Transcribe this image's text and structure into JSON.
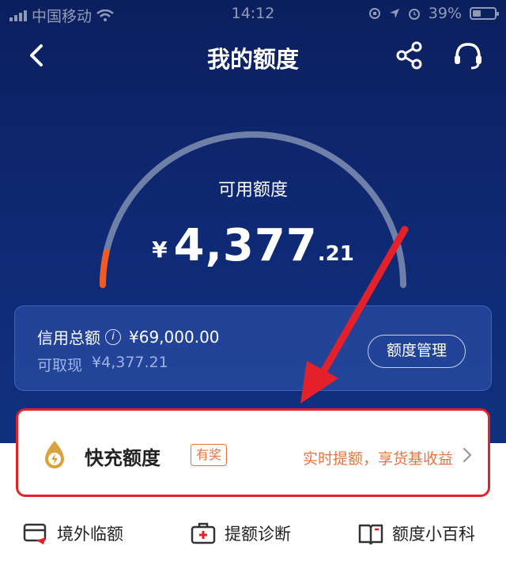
{
  "status_bar": {
    "carrier": "中国移动",
    "time": "14:12",
    "battery": "39%",
    "battery_level": 0.39
  },
  "nav": {
    "title": "我的额度"
  },
  "available": {
    "label": "可用额度",
    "currency": "¥",
    "amount_int": "4,377",
    "amount_dec": ".21"
  },
  "credit": {
    "total_label": "信用总额",
    "total_value": "¥69,000.00",
    "cash_label": "可取现",
    "cash_value": "¥4,377.21",
    "manage_label": "额度管理"
  },
  "quick_charge": {
    "title": "快充额度",
    "badge": "有奖",
    "promo": "实时提额，享货基收益"
  },
  "shortcuts": [
    {
      "label": "境外临额"
    },
    {
      "label": "提额诊断"
    },
    {
      "label": "额度小百科"
    }
  ],
  "colors": {
    "hero_bg": "#0f2a75",
    "accent_orange": "#e8743c",
    "annotation_red": "#e4202a"
  }
}
